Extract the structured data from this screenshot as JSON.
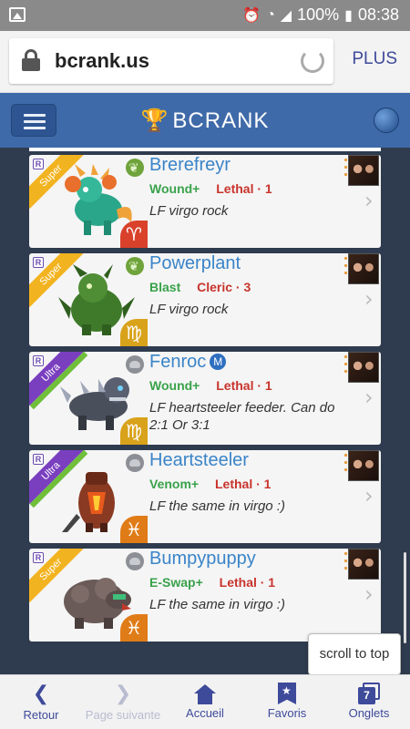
{
  "status_bar": {
    "battery": "100%",
    "time": "08:38"
  },
  "browser": {
    "url": "bcrank.us",
    "plus_label": "PLUS"
  },
  "header": {
    "brand": "BCRANK"
  },
  "cards": [
    {
      "rarity": "Super",
      "name": "Brerefreyr",
      "element": "nature",
      "trait_a": "Wound+",
      "trait_b": "Lethal · 1",
      "note": "LF virgo rock",
      "zodiac": "♈",
      "zodiac_name": "aries",
      "mentor": false
    },
    {
      "rarity": "Super",
      "name": "Powerplant",
      "element": "nature",
      "trait_a": "Blast",
      "trait_b": "Cleric · 3",
      "note": "LF virgo rock",
      "zodiac": "♍",
      "zodiac_name": "virgo",
      "mentor": false
    },
    {
      "rarity": "Ultra",
      "name": "Fenroc",
      "element": "earth",
      "trait_a": "Wound+",
      "trait_b": "Lethal · 1",
      "note": "LF heartsteeler feeder. Can do 2:1 Or 3:1",
      "zodiac": "♍",
      "zodiac_name": "virgo",
      "mentor": true,
      "mentor_label": "M"
    },
    {
      "rarity": "Ultra",
      "name": "Heartsteeler",
      "element": "earth",
      "trait_a": "Venom+",
      "trait_b": "Lethal · 1",
      "note": "LF the same in virgo :)",
      "zodiac": "♓",
      "zodiac_name": "pisces",
      "mentor": false
    },
    {
      "rarity": "Super",
      "name": "Bumpypuppy",
      "element": "earth",
      "trait_a": "E-Swap+",
      "trait_b": "Lethal · 1",
      "note": "LF the same in virgo :)",
      "zodiac": "♓",
      "zodiac_name": "pisces",
      "mentor": false
    }
  ],
  "scroll_to_top": "scroll to top",
  "bottom_nav": {
    "back": "Retour",
    "forward": "Page suivante",
    "home": "Accueil",
    "favorites": "Favoris",
    "tabs": "Onglets",
    "tabs_count": "7"
  }
}
